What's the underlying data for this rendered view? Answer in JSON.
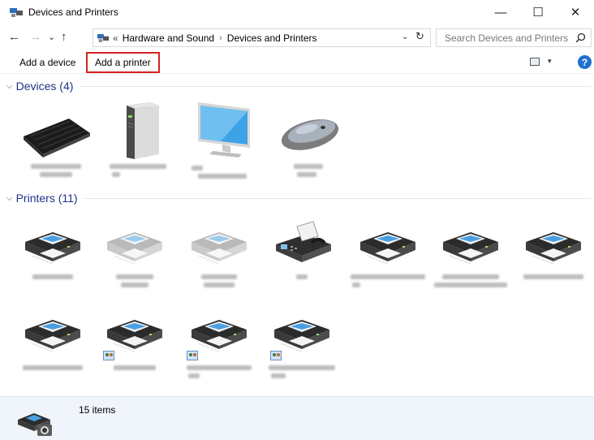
{
  "window": {
    "title": "Devices and Printers",
    "minimize": "—",
    "maximize": "☐",
    "close": "✕"
  },
  "nav": {
    "back": "←",
    "forward": "→",
    "recent": "⌄",
    "up": "↑"
  },
  "address": {
    "overflow": "«",
    "crumbs": [
      "Hardware and Sound",
      "Devices and Printers"
    ],
    "separator": "›",
    "dropdown": "⌄",
    "refresh": "↻"
  },
  "search": {
    "placeholder": "Search Devices and Printers"
  },
  "toolbar": {
    "add_device": "Add a device",
    "add_printer": "Add a printer",
    "view_dropdown": "▾",
    "help": "?"
  },
  "groups": {
    "devices": {
      "title": "Devices (4)",
      "chevron": "⌵"
    },
    "printers": {
      "title": "Printers (11)",
      "chevron": "⌵"
    }
  },
  "details": {
    "count": "15 items"
  },
  "colors": {
    "group_title": "#1e3287",
    "highlight_border": "#d92020",
    "accent": "#1f6fce"
  }
}
